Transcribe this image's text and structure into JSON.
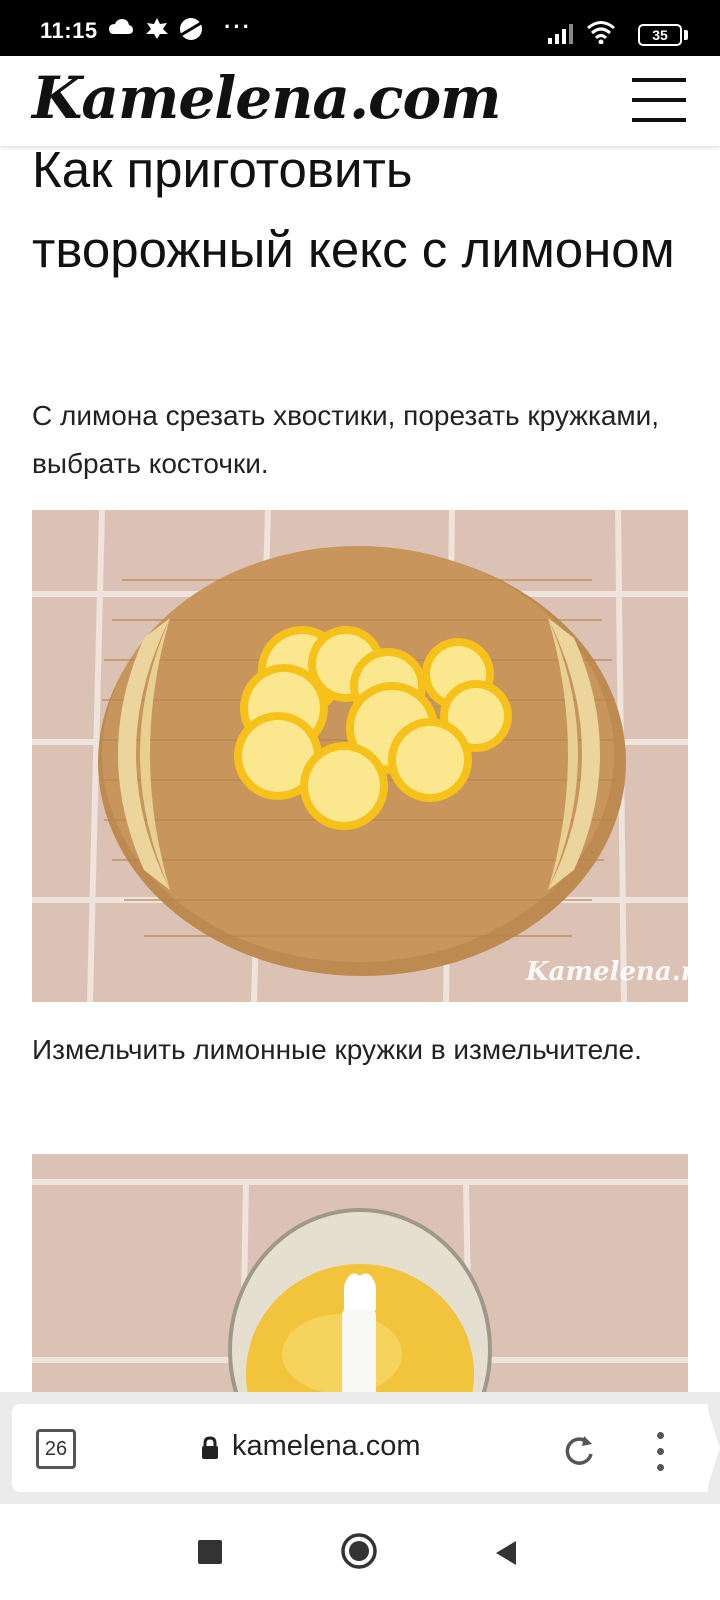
{
  "status_bar": {
    "time": "11:15",
    "dots": "···",
    "battery": "35"
  },
  "site": {
    "logo": "Kamelena.com",
    "menu_icon": "hamburger-menu-icon"
  },
  "article": {
    "title": "Как приготовить творожный кекс с лимоном",
    "steps": [
      {
        "text": "С лимона срезать хвостики, порезать кружками, выбрать косточки.",
        "image_watermark": "Kamelena.ru"
      },
      {
        "text": "Измельчить лимонные кружки в измельчителе."
      }
    ]
  },
  "browser": {
    "tab_count": "26",
    "url": "kamelena.com",
    "lock_icon": "lock-icon",
    "reload_icon": "reload-icon",
    "menu_icon": "more-vert-icon"
  },
  "navigation": {
    "recents_icon": "square-icon",
    "home_icon": "circle-home-icon",
    "back_icon": "triangle-back-icon"
  },
  "colors": {
    "status_bar_bg": "#000000",
    "page_bg": "#ffffff",
    "toolbar_bg": "#ebebeb",
    "tile": "#dcc2b4",
    "board": "#c8955c",
    "lemon": "#f6c21a"
  }
}
